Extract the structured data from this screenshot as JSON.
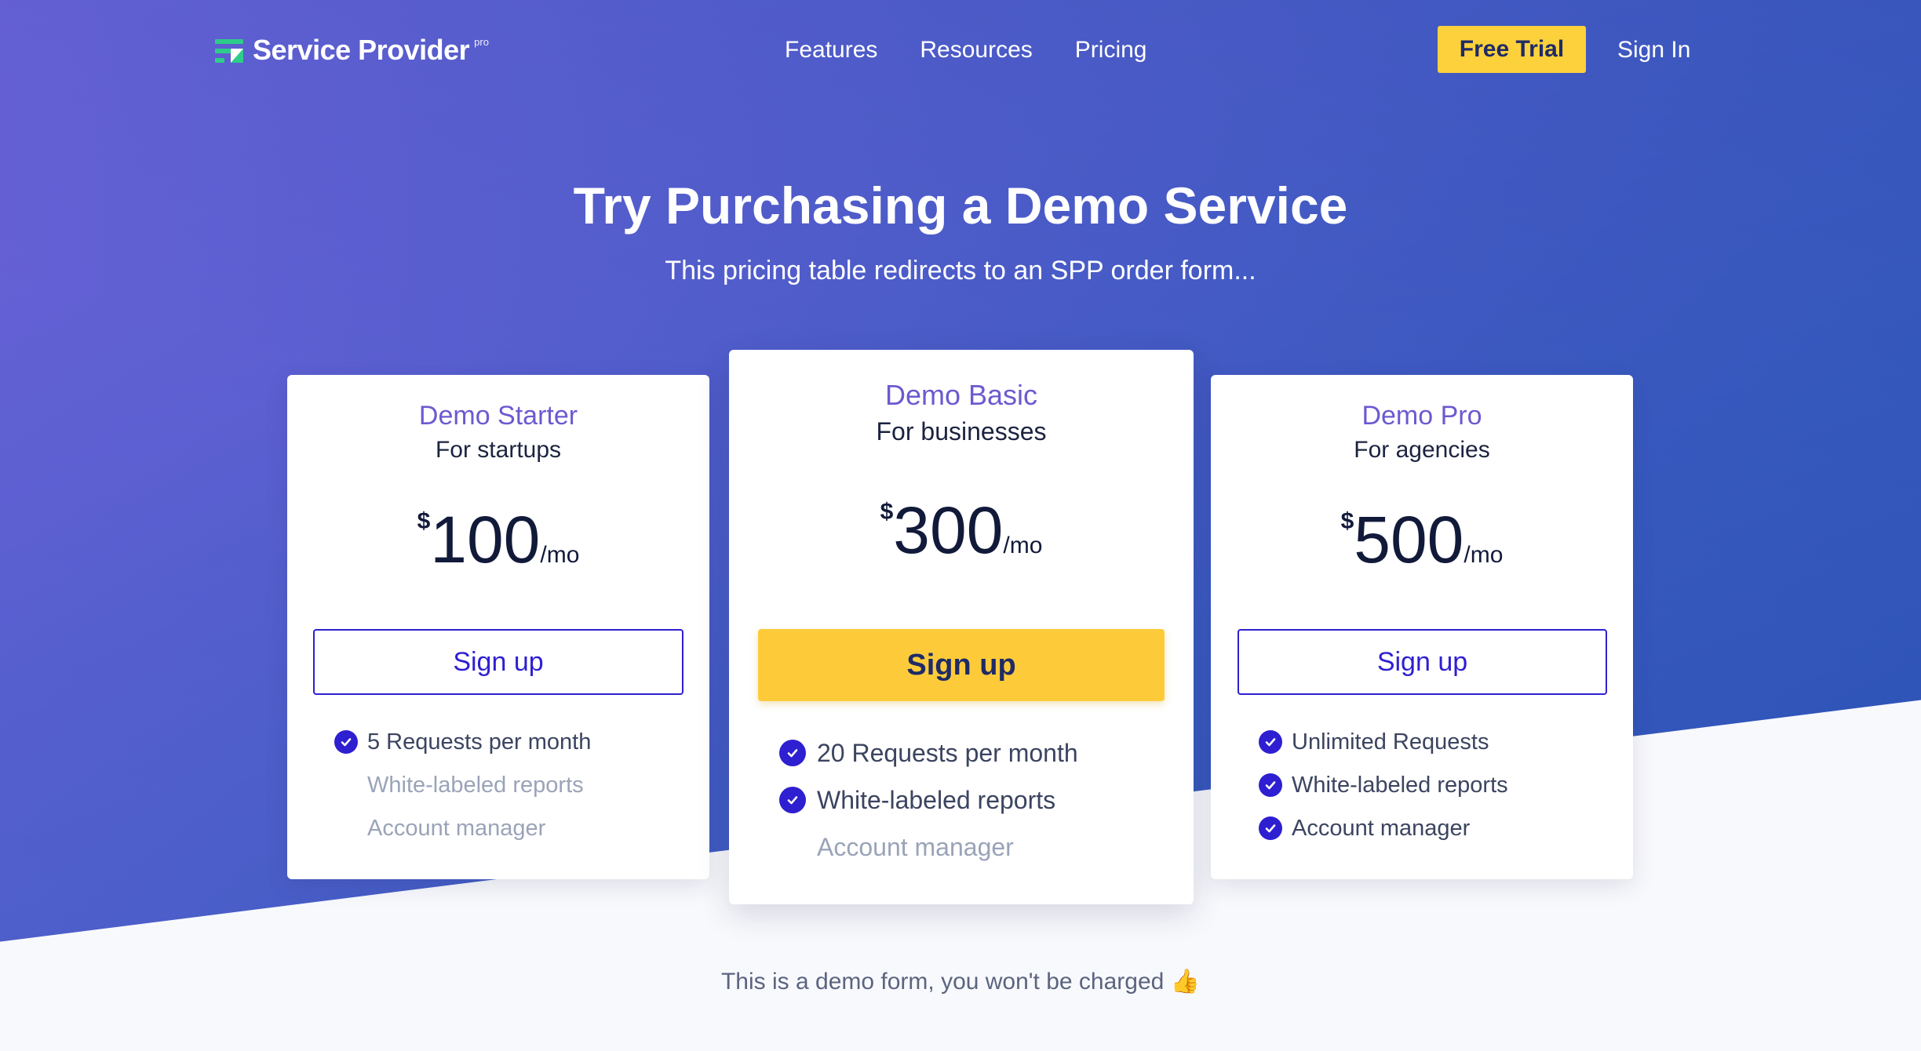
{
  "nav": {
    "logo_text": "Service Provider",
    "logo_badge": "pro",
    "links": [
      "Features",
      "Resources",
      "Pricing"
    ],
    "cta_label": "Free Trial",
    "signin_label": "Sign In"
  },
  "hero": {
    "title": "Try Purchasing a Demo Service",
    "subtitle": "This pricing table redirects to an SPP order form..."
  },
  "plans": [
    {
      "name": "Demo Starter",
      "audience": "For startups",
      "currency": "$",
      "amount": "100",
      "period": "/mo",
      "button_label": "Sign up",
      "features": [
        {
          "text": "5 Requests per month",
          "included": true
        },
        {
          "text": "White-labeled reports",
          "included": false
        },
        {
          "text": "Account manager",
          "included": false
        }
      ]
    },
    {
      "name": "Demo Basic",
      "audience": "For businesses",
      "currency": "$",
      "amount": "300",
      "period": "/mo",
      "button_label": "Sign up",
      "features": [
        {
          "text": "20 Requests per month",
          "included": true
        },
        {
          "text": "White-labeled reports",
          "included": true
        },
        {
          "text": "Account manager",
          "included": false
        }
      ]
    },
    {
      "name": "Demo Pro",
      "audience": "For agencies",
      "currency": "$",
      "amount": "500",
      "period": "/mo",
      "button_label": "Sign up",
      "features": [
        {
          "text": "Unlimited Requests",
          "included": true
        },
        {
          "text": "White-labeled reports",
          "included": true
        },
        {
          "text": "Account manager",
          "included": true
        }
      ]
    }
  ],
  "footnote": "This is a demo form, you won't be charged 👍",
  "colors": {
    "accent": "#2e1fd1",
    "cta_yellow": "#fdcb3a",
    "plan_name": "#6b5ad1"
  }
}
